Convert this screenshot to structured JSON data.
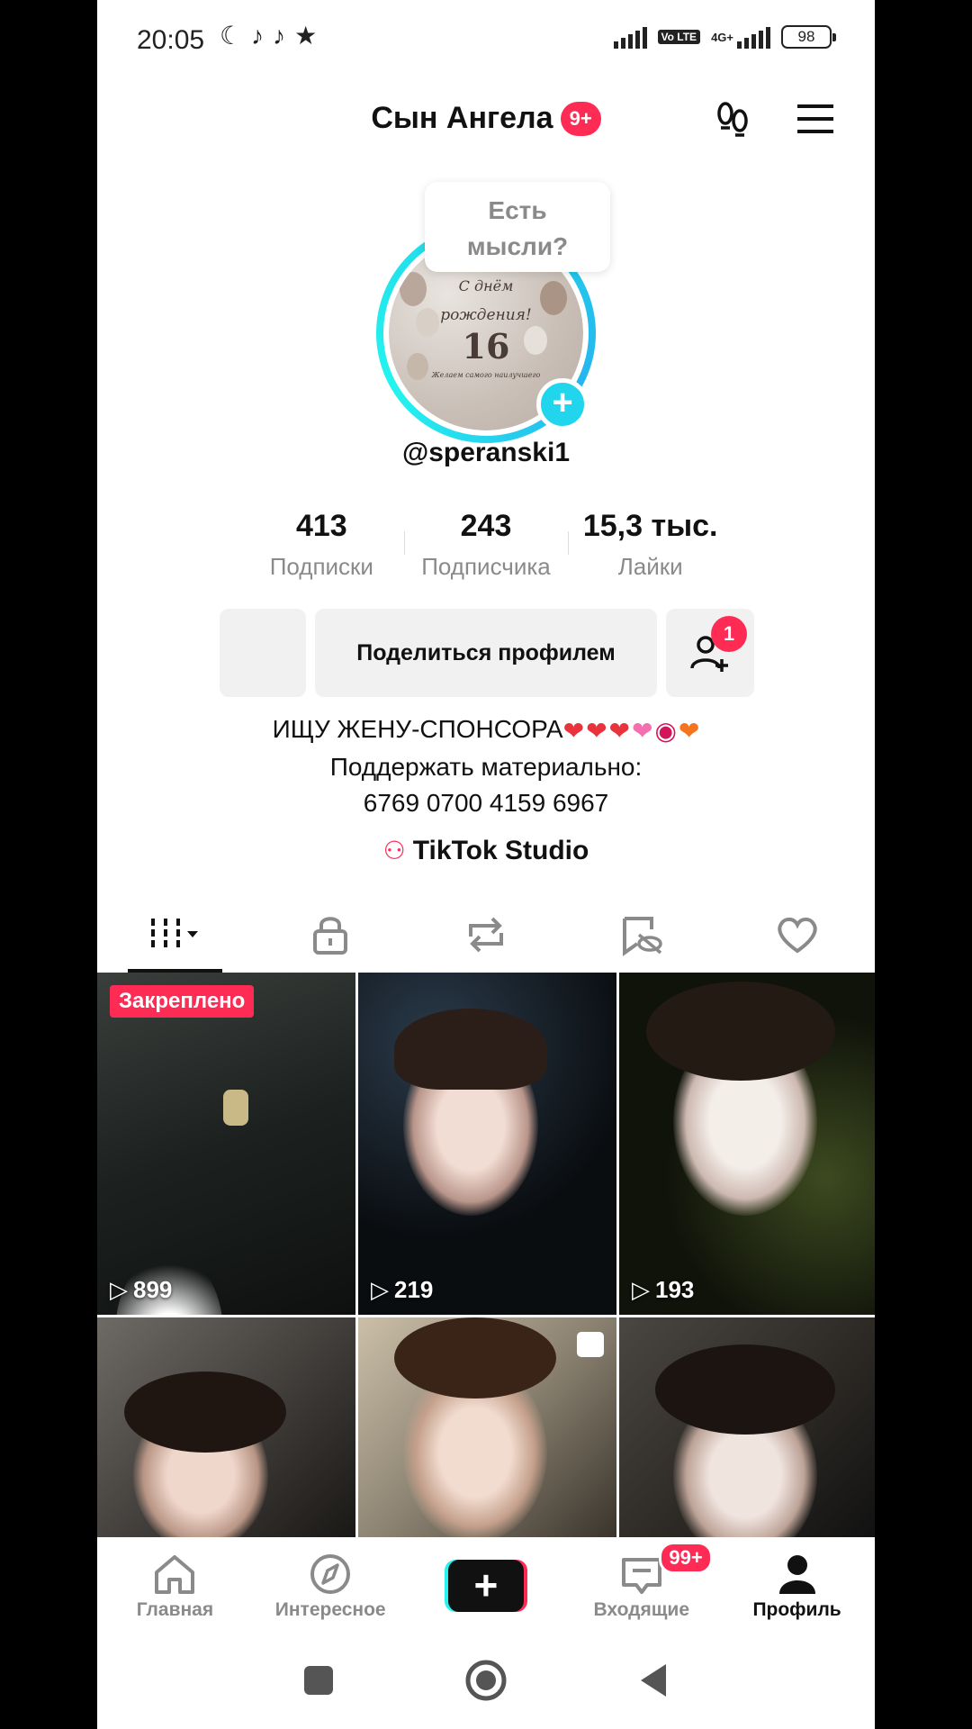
{
  "status_bar": {
    "time": "20:05",
    "battery": "98",
    "network_label": "4G+",
    "volte_label": "Vo LTE"
  },
  "header": {
    "title": "Сын Ангела",
    "notifications_badge": "9+"
  },
  "profile": {
    "thought_bubble": [
      "Есть",
      "мысли?"
    ],
    "avatar_text": [
      "С днём",
      "рождения!",
      "16",
      "Желаем самого наилучшего"
    ],
    "username": "@speranski1",
    "stats": [
      {
        "value": "413",
        "label": "Подписки"
      },
      {
        "value": "243",
        "label": "Подписчика"
      },
      {
        "value": "15,3 тыс.",
        "label": "Лайки"
      }
    ],
    "share_button": "Поделиться профилем",
    "add_friends_badge": "1",
    "bio": [
      "ИЩУ ЖЕНУ-СПОНСОРА",
      "Поддержать материально:",
      "6769 0700 4159 6967"
    ],
    "studio_link": "TikTok Studio"
  },
  "tabs": [
    {
      "icon": "videos-grid-icon",
      "active": true
    },
    {
      "icon": "lock-icon",
      "active": false
    },
    {
      "icon": "repost-icon",
      "active": false
    },
    {
      "icon": "tagged-hidden-icon",
      "active": false
    },
    {
      "icon": "heart-icon",
      "active": false
    }
  ],
  "videos": [
    {
      "views": "899",
      "pinned_label": "Закреплено"
    },
    {
      "views": "219"
    },
    {
      "views": "193"
    },
    {
      "views": ""
    },
    {
      "views": ""
    },
    {
      "views": ""
    }
  ],
  "bottom_nav": [
    {
      "label": "Главная",
      "icon": "home-icon"
    },
    {
      "label": "Интересное",
      "icon": "compass-icon"
    },
    {
      "label": "",
      "icon": "create-icon"
    },
    {
      "label": "Входящие",
      "icon": "inbox-icon",
      "badge": "99+"
    },
    {
      "label": "Профиль",
      "icon": "profile-icon"
    }
  ],
  "colors": {
    "accent_pink": "#fe2c55",
    "accent_cyan": "#25f4ee",
    "ring_cyan": "#20d5ec"
  }
}
